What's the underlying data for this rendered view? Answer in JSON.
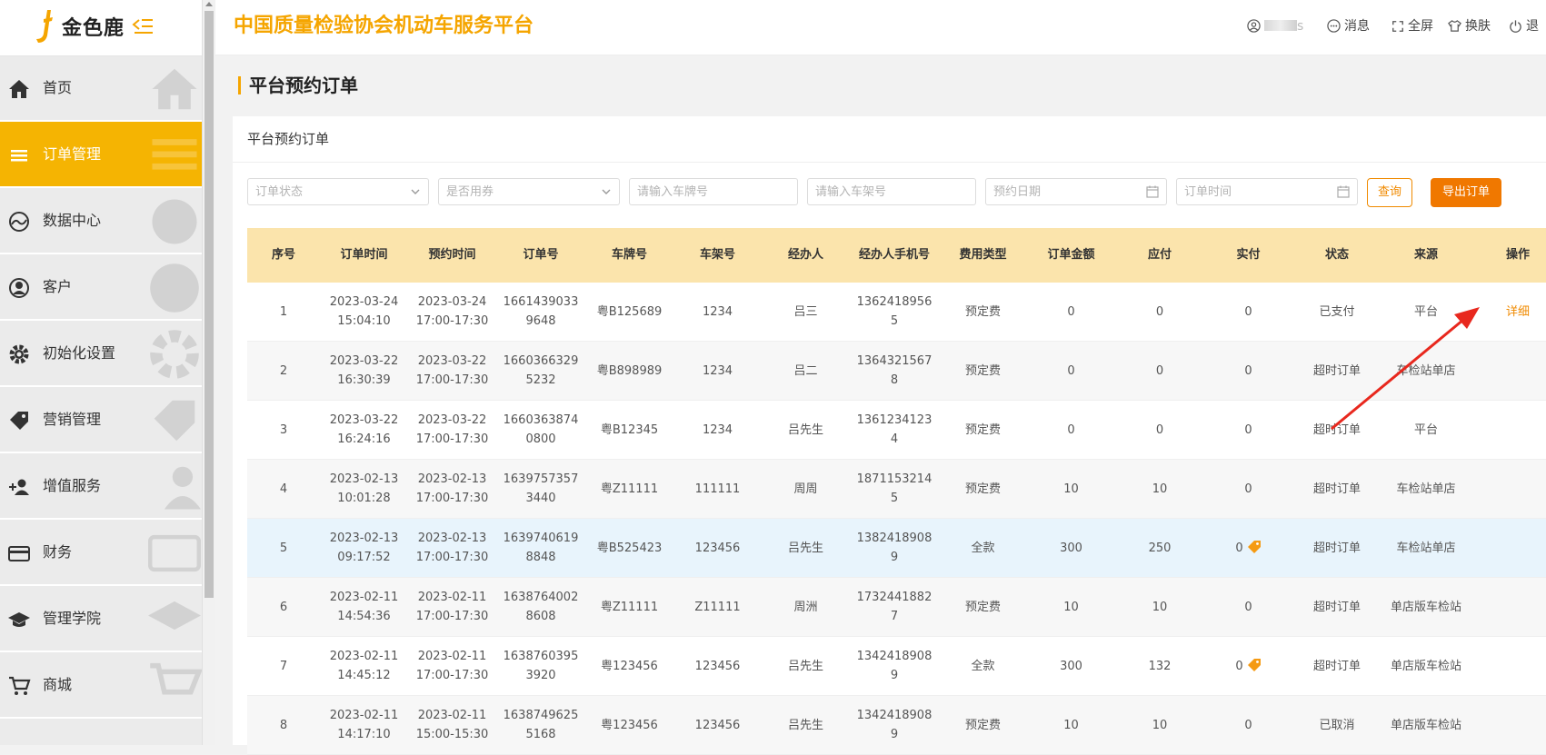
{
  "sidebar": {
    "logo_text": "金色鹿",
    "menu": [
      {
        "label": "首页",
        "icon": "home-icon",
        "active": false
      },
      {
        "label": "订单管理",
        "icon": "list-icon",
        "active": true
      },
      {
        "label": "数据中心",
        "icon": "chart-icon",
        "active": false
      },
      {
        "label": "客户",
        "icon": "user-icon",
        "active": false
      },
      {
        "label": "初始化设置",
        "icon": "gear-icon",
        "active": false
      },
      {
        "label": "营销管理",
        "icon": "tag-icon",
        "active": false
      },
      {
        "label": "增值服务",
        "icon": "add-user-icon",
        "active": false
      },
      {
        "label": "财务",
        "icon": "card-icon",
        "active": false
      },
      {
        "label": "管理学院",
        "icon": "graduation-cap-icon",
        "active": false
      },
      {
        "label": "商城",
        "icon": "cart-icon",
        "active": false
      }
    ]
  },
  "header": {
    "title": "中国质量检验协会机动车服务平台",
    "user_suffix": "s",
    "messages": "消息",
    "fullscreen": "全屏",
    "skin": "换肤",
    "logout": "退"
  },
  "page": {
    "title": "平台预约订单",
    "card_title": "平台预约订单"
  },
  "filters": {
    "order_status": "订单状态",
    "coupon_used": "是否用券",
    "plate_no": "请输入车牌号",
    "vin": "请输入车架号",
    "appt_date": "预约日期",
    "order_time": "订单时间",
    "query": "查询",
    "export": "导出订单"
  },
  "table": {
    "headers": [
      "序号",
      "订单时间",
      "预约时间",
      "订单号",
      "车牌号",
      "车架号",
      "经办人",
      "经办人手机号",
      "费用类型",
      "订单金额",
      "应付",
      "实付",
      "状态",
      "来源",
      "操作"
    ],
    "rows": [
      {
        "seq": "1",
        "order_time": "2023-03-24 15:04:10",
        "appt_time": "2023-03-24 17:00-17:30",
        "order_no": "16614390339648",
        "plate": "粤B125689",
        "vin": "1234",
        "handler": "吕三",
        "phone": "13624189565",
        "fee_type": "预定费",
        "amount": "0",
        "payable": "0",
        "paid": "0",
        "coupon": false,
        "status": "已支付",
        "source": "平台",
        "action": "详细"
      },
      {
        "seq": "2",
        "order_time": "2023-03-22 16:30:39",
        "appt_time": "2023-03-22 17:00-17:30",
        "order_no": "16603663295232",
        "plate": "粤B898989",
        "vin": "1234",
        "handler": "吕二",
        "phone": "13643215678",
        "fee_type": "预定费",
        "amount": "0",
        "payable": "0",
        "paid": "0",
        "coupon": false,
        "status": "超时订单",
        "source": "车检站单店",
        "action": ""
      },
      {
        "seq": "3",
        "order_time": "2023-03-22 16:24:16",
        "appt_time": "2023-03-22 17:00-17:30",
        "order_no": "16603638740800",
        "plate": "粤B12345",
        "vin": "1234",
        "handler": "吕先生",
        "phone": "13612341234",
        "fee_type": "预定费",
        "amount": "0",
        "payable": "0",
        "paid": "0",
        "coupon": false,
        "status": "超时订单",
        "source": "平台",
        "action": ""
      },
      {
        "seq": "4",
        "order_time": "2023-02-13 10:01:28",
        "appt_time": "2023-02-13 17:00-17:30",
        "order_no": "16397573573440",
        "plate": "粤Z11111",
        "vin": "111111",
        "handler": "周周",
        "phone": "18711532145",
        "fee_type": "预定费",
        "amount": "10",
        "payable": "10",
        "paid": "0",
        "coupon": false,
        "status": "超时订单",
        "source": "车检站单店",
        "action": ""
      },
      {
        "seq": "5",
        "order_time": "2023-02-13 09:17:52",
        "appt_time": "2023-02-13 17:00-17:30",
        "order_no": "16397406198848",
        "plate": "粤B525423",
        "vin": "123456",
        "handler": "吕先生",
        "phone": "13824189089",
        "fee_type": "全款",
        "amount": "300",
        "payable": "250",
        "paid": "0",
        "coupon": true,
        "status": "超时订单",
        "source": "车检站单店",
        "action": ""
      },
      {
        "seq": "6",
        "order_time": "2023-02-11 14:54:36",
        "appt_time": "2023-02-11 17:00-17:30",
        "order_no": "16387640028608",
        "plate": "粤Z11111",
        "vin": "Z11111",
        "handler": "周洲",
        "phone": "17324418827",
        "fee_type": "预定费",
        "amount": "10",
        "payable": "10",
        "paid": "0",
        "coupon": false,
        "status": "超时订单",
        "source": "单店版车检站",
        "action": ""
      },
      {
        "seq": "7",
        "order_time": "2023-02-11 14:45:12",
        "appt_time": "2023-02-11 17:00-17:30",
        "order_no": "16387603953920",
        "plate": "粤123456",
        "vin": "123456",
        "handler": "吕先生",
        "phone": "13424189089",
        "fee_type": "全款",
        "amount": "300",
        "payable": "132",
        "paid": "0",
        "coupon": true,
        "status": "超时订单",
        "source": "单店版车检站",
        "action": ""
      },
      {
        "seq": "8",
        "order_time": "2023-02-11 14:17:10",
        "appt_time": "2023-02-11 15:00-15:30",
        "order_no": "16387496255168",
        "plate": "粤123456",
        "vin": "123456",
        "handler": "吕先生",
        "phone": "13424189089",
        "fee_type": "预定费",
        "amount": "10",
        "payable": "10",
        "paid": "0",
        "coupon": false,
        "status": "已取消",
        "source": "单店版车检站",
        "action": ""
      }
    ]
  },
  "colors": {
    "accent": "#f5b402",
    "title": "#f5a500",
    "link": "#f08a00",
    "header_row": "#fbe4ac",
    "arrow": "#e8281e"
  }
}
